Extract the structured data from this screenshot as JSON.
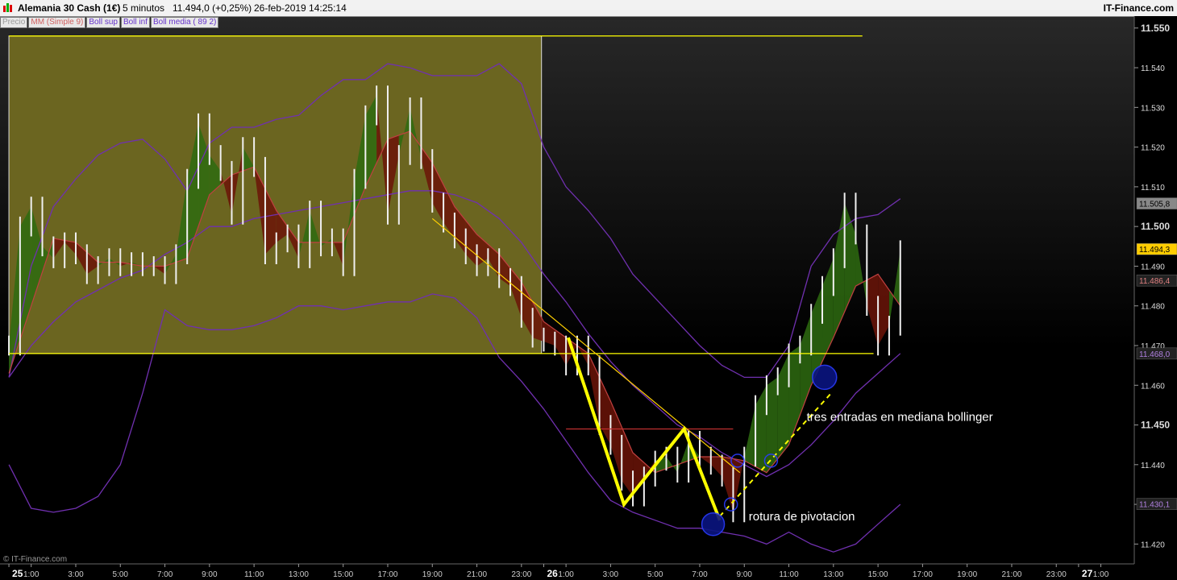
{
  "header": {
    "instrument": "Alemania 30 Cash (1€)",
    "timeframe": "5 minutos",
    "price_change": "11.494,0 (+0,25%)",
    "datetime": "26-feb-2019 14:25:14",
    "brand": "IT-Finance.com"
  },
  "legend": [
    {
      "label": "Precio",
      "color": "#999999"
    },
    {
      "label": "MM (Simple 9)",
      "color": "#d06060"
    },
    {
      "label": "Boll sup",
      "color": "#6633cc"
    },
    {
      "label": "Boll inf",
      "color": "#6633cc"
    },
    {
      "label": "Boll media ( 89 2)",
      "color": "#6633cc"
    }
  ],
  "watermark": "© IT-Finance.com",
  "colors": {
    "yellow_line": "#ffff00",
    "zone_box": "#6b6520",
    "bull_fill": "#2e6b10",
    "bear_fill": "#6b1408",
    "bollinger": "#7030b0",
    "sma": "#c04040"
  },
  "chart_data": {
    "type": "line",
    "ylim": [
      11415,
      11553
    ],
    "y_ticks": [
      "11.550",
      "11.540",
      "11.530",
      "11.520",
      "11.510",
      "11.500",
      "11.490",
      "11.480",
      "11.470",
      "11.460",
      "11.450",
      "11.440",
      "11.430",
      "11.420"
    ],
    "y_tick_values": [
      11550,
      11540,
      11530,
      11520,
      11510,
      11500,
      11490,
      11480,
      11470,
      11460,
      11450,
      11440,
      11430,
      11420
    ],
    "x_ticks": [
      "25",
      "1:00",
      "3:00",
      "5:00",
      "7:00",
      "9:00",
      "11:00",
      "13:00",
      "15:00",
      "17:00",
      "19:00",
      "21:00",
      "23:00",
      "26",
      "1:00",
      "3:00",
      "5:00",
      "7:00",
      "9:00",
      "11:00",
      "13:00",
      "15:00",
      "17:00",
      "19:00",
      "21:00",
      "23:00",
      "27",
      "1:00"
    ],
    "x_tick_hours": [
      0,
      1,
      3,
      5,
      7,
      9,
      11,
      13,
      15,
      17,
      19,
      21,
      23,
      24,
      25,
      27,
      29,
      31,
      33,
      35,
      37,
      39,
      41,
      43,
      45,
      47,
      48,
      49
    ],
    "x_range_hours": [
      -0.4,
      50.5
    ],
    "price_labels": [
      {
        "text": "11.505,8",
        "value": 11505.8,
        "color": "#888888",
        "text_color": "#000000"
      },
      {
        "text": "11.494,3",
        "value": 11494.3,
        "color": "#ffcc00",
        "text_color": "#000000"
      },
      {
        "text": "11.486,4",
        "value": 11486.4,
        "color": "#222222",
        "text_color": "#e08080"
      },
      {
        "text": "11.468,0",
        "value": 11468.0,
        "color": "#222222",
        "text_color": "#b080e0"
      },
      {
        "text": "11.430,1",
        "value": 11430.1,
        "color": "#222222",
        "text_color": "#b080e0"
      }
    ],
    "series": [
      {
        "name": "Precio",
        "x": [
          0,
          0.5,
          1,
          1.5,
          2,
          2.5,
          3,
          3.5,
          4,
          4.5,
          5,
          5.5,
          6,
          6.5,
          7,
          7.5,
          8,
          8.5,
          9,
          9.5,
          10,
          10.5,
          11,
          11.5,
          12,
          12.5,
          13,
          13.5,
          14,
          14.5,
          15,
          15.5,
          16,
          16.5,
          17,
          17.5,
          18,
          18.5,
          19,
          19.5,
          20,
          20.5,
          21,
          21.5,
          22,
          22.5,
          23,
          23.5,
          24,
          24.5,
          25,
          25.5,
          26,
          26.5,
          27,
          27.5,
          28,
          28.5,
          29,
          29.5,
          30,
          30.5,
          31,
          31.5,
          32,
          32.5,
          33,
          33.5,
          34,
          34.5,
          35,
          35.5,
          36,
          36.5,
          37,
          37.5,
          38,
          38.5,
          39,
          39.5,
          40
        ],
        "values": [
          11470,
          11500,
          11505,
          11495,
          11492,
          11496,
          11493,
          11488,
          11490,
          11492,
          11490,
          11491,
          11490,
          11490,
          11488,
          11493,
          11512,
          11526,
          11518,
          11514,
          11503,
          11520,
          11515,
          11493,
          11496,
          11498,
          11492,
          11504,
          11495,
          11497,
          11490,
          11512,
          11528,
          11533,
          11503,
          11518,
          11530,
          11517,
          11506,
          11501,
          11497,
          11493,
          11490,
          11492,
          11487,
          11485,
          11477,
          11472,
          11471,
          11470,
          11465,
          11470,
          11465,
          11450,
          11445,
          11436,
          11432,
          11437,
          11441,
          11442,
          11438,
          11446,
          11442,
          11440,
          11437,
          11428,
          11442,
          11455,
          11460,
          11462,
          11468,
          11470,
          11478,
          11485,
          11492,
          11506,
          11498,
          11480,
          11470,
          11475,
          11494
        ]
      },
      {
        "name": "MM (Simple 9)",
        "x": [
          0,
          1,
          2,
          3,
          4,
          5,
          6,
          7,
          8,
          9,
          10,
          11,
          12,
          13,
          14,
          15,
          16,
          17,
          18,
          19,
          20,
          21,
          22,
          23,
          24,
          25,
          26,
          27,
          28,
          29,
          30,
          31,
          32,
          33,
          34,
          35,
          36,
          37,
          38,
          39,
          40
        ],
        "values": [
          11463,
          11480,
          11497,
          11496,
          11491,
          11491,
          11490,
          11490,
          11492,
          11508,
          11513,
          11515,
          11504,
          11496,
          11496,
          11496,
          11510,
          11522,
          11524,
          11516,
          11505,
          11498,
          11493,
          11486,
          11476,
          11472,
          11468,
          11456,
          11443,
          11438,
          11440,
          11442,
          11442,
          11441,
          11438,
          11445,
          11460,
          11472,
          11485,
          11488,
          11480
        ]
      },
      {
        "name": "Boll sup",
        "x": [
          0,
          1,
          2,
          3,
          4,
          5,
          6,
          7,
          8,
          9,
          10,
          11,
          12,
          13,
          14,
          15,
          16,
          17,
          18,
          19,
          20,
          21,
          22,
          23,
          24,
          25,
          26,
          27,
          28,
          29,
          30,
          31,
          32,
          33,
          34,
          35,
          36,
          37,
          38,
          39,
          40
        ],
        "values": [
          11462,
          11490,
          11505,
          11512,
          11518,
          11521,
          11522,
          11517,
          11509,
          11521,
          11525,
          11525,
          11527,
          11528,
          11533,
          11537,
          11537,
          11541,
          11540,
          11538,
          11538,
          11538,
          11541,
          11536,
          11520,
          11510,
          11504,
          11497,
          11488,
          11482,
          11476,
          11470,
          11465,
          11462,
          11462,
          11470,
          11490,
          11498,
          11502,
          11503,
          11507
        ]
      },
      {
        "name": "Boll media ( 89 2)",
        "x": [
          0,
          1,
          2,
          3,
          4,
          5,
          6,
          7,
          8,
          9,
          10,
          11,
          12,
          13,
          14,
          15,
          16,
          17,
          18,
          19,
          20,
          21,
          22,
          23,
          24,
          25,
          26,
          27,
          28,
          29,
          30,
          31,
          32,
          33,
          34,
          35,
          36,
          37,
          38,
          39,
          40
        ],
        "values": [
          11462,
          11470,
          11476,
          11481,
          11484,
          11487,
          11489,
          11493,
          11496,
          11500,
          11500,
          11502,
          11503,
          11504,
          11505,
          11506,
          11507,
          11508,
          11509,
          11509,
          11508,
          11506,
          11502,
          11496,
          11488,
          11481,
          11473,
          11466,
          11460,
          11455,
          11450,
          11447,
          11443,
          11440,
          11437,
          11440,
          11445,
          11451,
          11458,
          11463,
          11468
        ]
      },
      {
        "name": "Boll inf",
        "x": [
          0,
          1,
          2,
          3,
          4,
          5,
          6,
          7,
          8,
          9,
          10,
          11,
          12,
          13,
          14,
          15,
          16,
          17,
          18,
          19,
          20,
          21,
          22,
          23,
          24,
          25,
          26,
          27,
          28,
          29,
          30,
          31,
          32,
          33,
          34,
          35,
          36,
          37,
          38,
          39,
          40
        ],
        "values": [
          11440,
          11429,
          11428,
          11429,
          11432,
          11440,
          11458,
          11479,
          11475,
          11474,
          11474,
          11475,
          11477,
          11480,
          11480,
          11479,
          11480,
          11481,
          11481,
          11483,
          11482,
          11477,
          11467,
          11461,
          11454,
          11446,
          11438,
          11431,
          11428,
          11426,
          11424,
          11424,
          11423,
          11422,
          11420,
          11423,
          11420,
          11418,
          11420,
          11425,
          11430
        ]
      }
    ],
    "annotations": [
      {
        "text": "tres entradas en mediana bollinger",
        "x": 35.8,
        "y": 11451
      },
      {
        "text": "rotura de pivotacion",
        "x": 33.2,
        "y": 11426
      }
    ],
    "zone_box": {
      "x0": 0,
      "x1": 23.9,
      "y0": 11468,
      "y1": 11548
    },
    "horizontal_lines": [
      {
        "value": 11548,
        "x0": 0,
        "x1": 38.3
      },
      {
        "value": 11468,
        "x0": 0,
        "x1": 38.8
      },
      {
        "value": 11449,
        "x0": 25,
        "x1": 32.5
      }
    ],
    "trend_line": {
      "x": [
        19,
        32.8
      ],
      "y": [
        11502,
        11438
      ]
    },
    "zigzag": {
      "x": [
        25.1,
        27.6,
        30.3,
        31.9
      ],
      "y": [
        11472,
        11430,
        11449,
        11426
      ]
    },
    "dashed_line": {
      "x": [
        31.9,
        36.9
      ],
      "y": [
        11427,
        11458
      ]
    },
    "circles": [
      {
        "x": 31.6,
        "y": 11425
      },
      {
        "x": 32.4,
        "y": 11430
      },
      {
        "x": 32.7,
        "y": 11441
      },
      {
        "x": 34.2,
        "y": 11441
      },
      {
        "x": 36.6,
        "y": 11462
      }
    ]
  }
}
